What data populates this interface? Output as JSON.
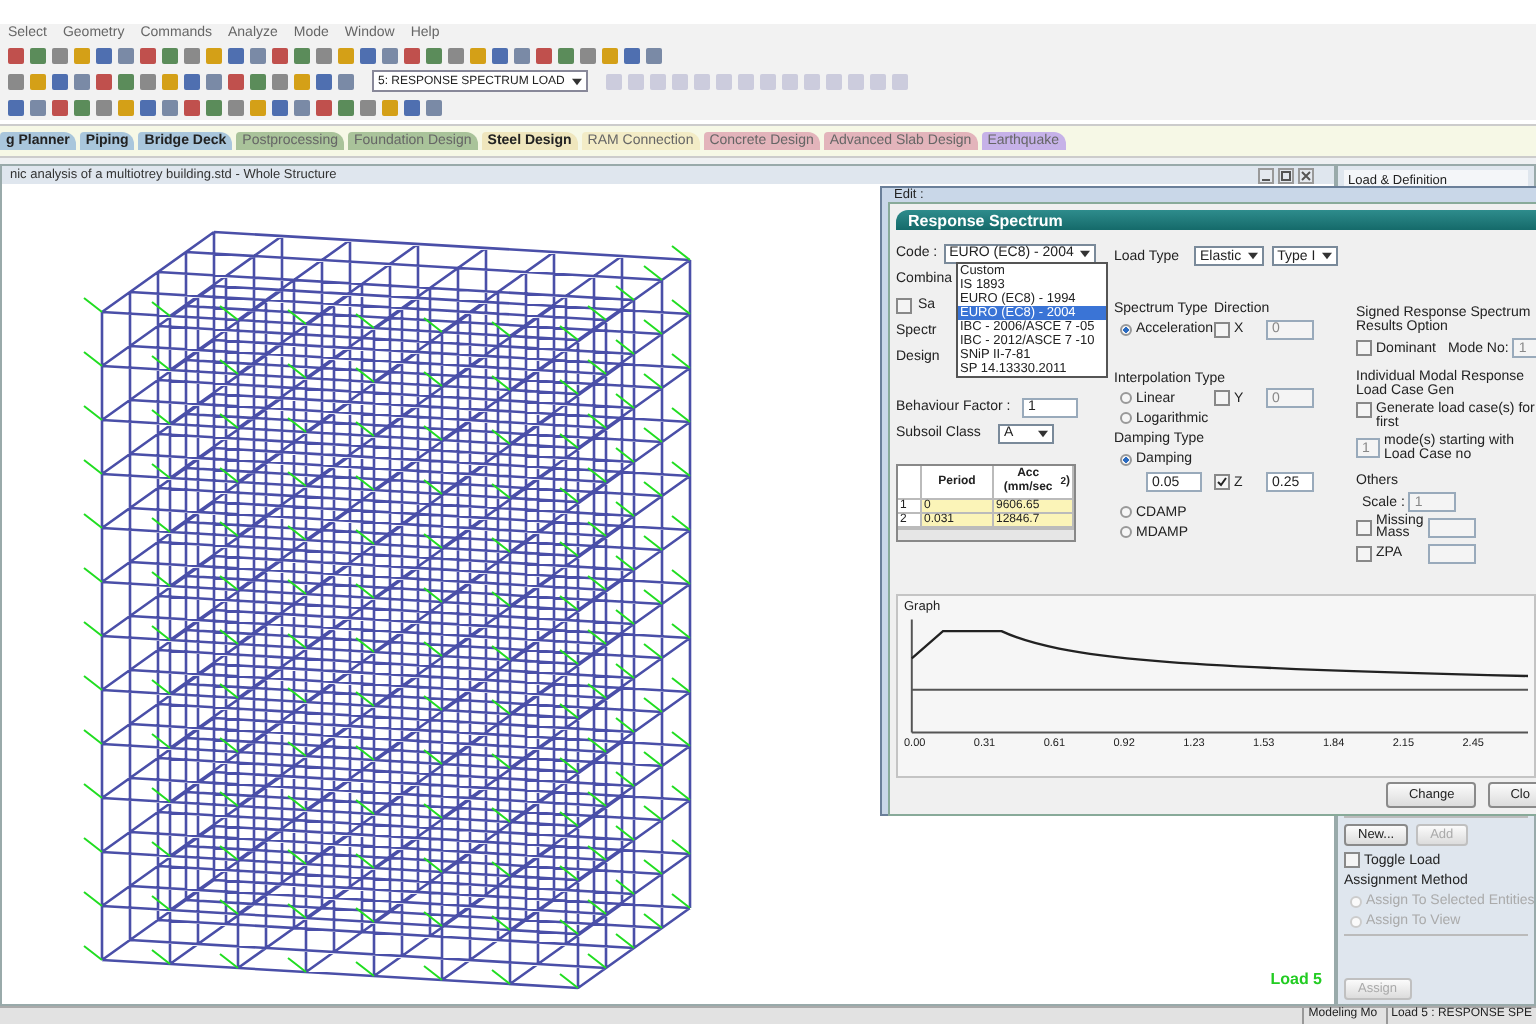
{
  "menu": [
    "Select",
    "Geometry",
    "Commands",
    "Analyze",
    "Mode",
    "Window",
    "Help"
  ],
  "toolbar": {
    "load_dropdown": "5: RESPONSE SPECTRUM LOAD"
  },
  "workflow_tabs": [
    {
      "label": "g Planner",
      "color": "#a9c6dc",
      "disabled": false
    },
    {
      "label": "Piping",
      "color": "#a9c6dc",
      "disabled": false
    },
    {
      "label": "Bridge Deck",
      "color": "#a9c6dc",
      "disabled": false
    },
    {
      "label": "Postprocessing",
      "color": "#a9c39a",
      "disabled": true
    },
    {
      "label": "Foundation Design",
      "color": "#a9c39a",
      "disabled": true
    },
    {
      "label": "Steel Design",
      "color": "#efe6bd",
      "disabled": false
    },
    {
      "label": "RAM Connection",
      "color": "#f3ecc6",
      "disabled": true
    },
    {
      "label": "Concrete Design",
      "color": "#e3b4bb",
      "disabled": true
    },
    {
      "label": "Advanced Slab Design",
      "color": "#e3b4bb",
      "disabled": true
    },
    {
      "label": "Earthquake",
      "color": "#c6b2e8",
      "disabled": true
    }
  ],
  "viewport": {
    "title": "nic analysis of a multiotrey building.std - Whole Structure",
    "load_label": "Load 5"
  },
  "dialog": {
    "caption": "Edit :",
    "title": "Response Spectrum",
    "code": {
      "label": "Code :",
      "value": "EURO (EC8) - 2004",
      "options": [
        {
          "label": "Custom",
          "selected": false
        },
        {
          "label": "IS 1893",
          "selected": false
        },
        {
          "label": "EURO (EC8) - 1994",
          "selected": false
        },
        {
          "label": "EURO (EC8) - 2004",
          "selected": true
        },
        {
          "label": "IBC - 2006/ASCE 7 -05",
          "selected": false
        },
        {
          "label": "IBC - 2012/ASCE 7 -10",
          "selected": false
        },
        {
          "label": "SNiP II-7-81",
          "selected": false
        },
        {
          "label": "SP 14.13330.2011",
          "selected": false
        }
      ]
    },
    "covered_rows": [
      {
        "kind": "label",
        "label": "Combina"
      },
      {
        "kind": "checkbox",
        "label": "Sa",
        "checked": false
      },
      {
        "kind": "label",
        "label": "Spectr"
      },
      {
        "kind": "label",
        "label": "Design"
      }
    ],
    "behaviour_factor": {
      "label": "Behaviour Factor :",
      "value": "1"
    },
    "subsoil_class": {
      "label": "Subsoil Class",
      "value": "A"
    },
    "table": {
      "columns": [
        "Period",
        "Acc (mm/sec$^{2}$)"
      ],
      "rows": [
        {
          "index": "1",
          "cells": [
            "0",
            "9606.65"
          ]
        },
        {
          "index": "2",
          "cells": [
            "0.031",
            "12846.7"
          ]
        }
      ]
    },
    "load_type": {
      "label": "Load Type",
      "values": [
        "Elastic",
        "Type I"
      ]
    },
    "spectrum_type": {
      "label": "Spectrum Type",
      "options": [
        {
          "label": "Acceleration",
          "selected": true
        }
      ]
    },
    "direction": {
      "label": "Direction",
      "axes": [
        {
          "label": "X",
          "checked": false,
          "value": "0"
        },
        {
          "label": "Y",
          "checked": false,
          "value": "0"
        },
        {
          "label": "Z",
          "checked": true,
          "value": "0.25"
        }
      ]
    },
    "interpolation_type": {
      "label": "Interpolation Type",
      "options": [
        {
          "label": "Linear",
          "selected": false
        },
        {
          "label": "Logarithmic",
          "selected": false
        }
      ]
    },
    "damping_type": {
      "label": "Damping Type",
      "value": "0.05",
      "options": [
        {
          "label": "Damping",
          "selected": true
        },
        {
          "label": "CDAMP",
          "selected": false
        },
        {
          "label": "MDAMP",
          "selected": false
        }
      ]
    },
    "signed_results": {
      "title": "Signed Response Spectrum Results Option",
      "dominant": {
        "label": "Dominant",
        "checked": false
      },
      "mode_no_label": "Mode No:",
      "mode_no": "1"
    },
    "modal_load_case": {
      "title": "Individual Modal Response Load Case Gen",
      "generate": {
        "label": "Generate load case(s) for first",
        "checked": false
      },
      "modes": "1",
      "modes_label": "mode(s) starting with Load Case no"
    },
    "others": {
      "title": "Others",
      "scale_label": "Scale :",
      "scale": "1",
      "missing_mass": {
        "label": "Missing Mass",
        "checked": false
      },
      "zpa": {
        "label": "ZPA",
        "checked": false
      }
    },
    "graph": {
      "label": "Graph",
      "x_ticks": [
        "0.00",
        "0.31",
        "0.61",
        "0.92",
        "1.23",
        "1.53",
        "1.84",
        "2.15",
        "2.45"
      ]
    },
    "buttons": [
      "Change",
      "Clo"
    ]
  },
  "load_panel": {
    "title": "Load & Definition",
    "buttons": [
      {
        "label": "New...",
        "disabled": false
      },
      {
        "label": "Add",
        "disabled": true
      }
    ],
    "toggle_load": {
      "label": "Toggle Load",
      "checked": false
    },
    "assignment_method": "Assignment Method",
    "assign_options": [
      {
        "label": "Assign To Selected Entities",
        "disabled": true
      },
      {
        "label": "Assign To View",
        "disabled": true
      }
    ],
    "assign_button": {
      "label": "Assign",
      "disabled": true
    }
  },
  "status_bar": [
    "Modeling Mo",
    "Load 5 : RESPONSE SPE"
  ]
}
